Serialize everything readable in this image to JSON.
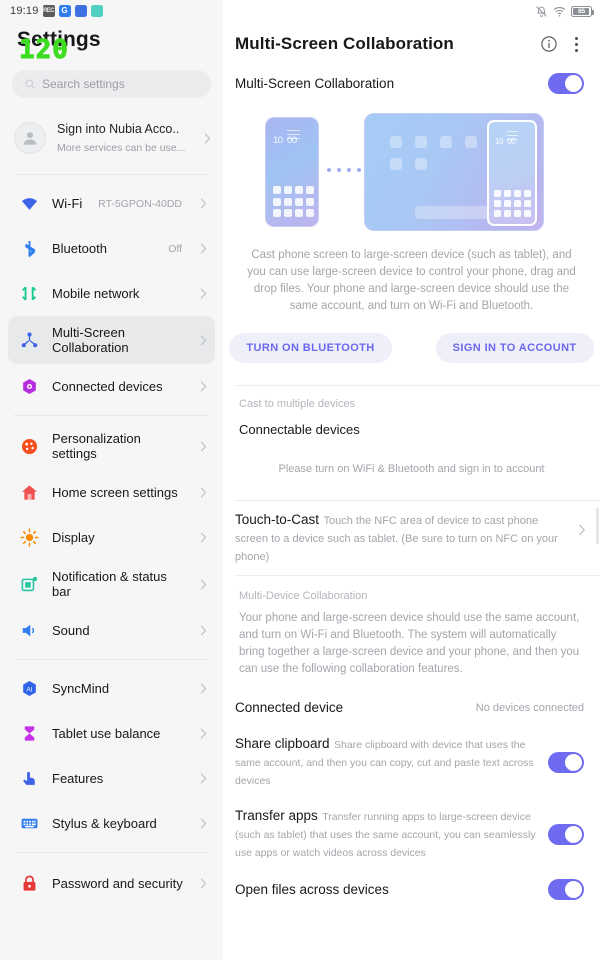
{
  "status_bar": {
    "time": "19:19",
    "left_icons": [
      "recorder-chip",
      "google-chip",
      "blue-app-chip",
      "teal-app-chip"
    ],
    "right_icons": [
      "mute-icon",
      "wifi-icon",
      "battery-icon"
    ],
    "battery_level": "85"
  },
  "sidebar": {
    "title": "Settings",
    "fps_overlay": "120",
    "search": {
      "placeholder": "Search settings",
      "icon": "search-icon"
    },
    "account": {
      "title": "Sign into Nubia Acco..",
      "subtitle": "More services can be use...",
      "icon": "avatar-icon"
    },
    "items": [
      {
        "label": "Wi-Fi",
        "value": "RT-5GPON-40DD",
        "icon": "wifi-icon",
        "selected": false
      },
      {
        "label": "Bluetooth",
        "value": "Off",
        "icon": "bluetooth-icon",
        "selected": false
      },
      {
        "label": "Mobile network",
        "value": "",
        "icon": "mobile-network-icon",
        "selected": false
      },
      {
        "label": "Multi-Screen Collaboration",
        "value": "",
        "icon": "multi-screen-icon",
        "selected": true
      },
      {
        "label": "Connected devices",
        "value": "",
        "icon": "connected-devices-icon",
        "selected": false
      },
      {
        "label": "Personalization settings",
        "value": "",
        "icon": "palette-icon",
        "selected": false
      },
      {
        "label": "Home screen settings",
        "value": "",
        "icon": "home-icon",
        "selected": false
      },
      {
        "label": "Display",
        "value": "",
        "icon": "sun-icon",
        "selected": false
      },
      {
        "label": "Notification & status bar",
        "value": "",
        "icon": "notification-icon",
        "selected": false
      },
      {
        "label": "Sound",
        "value": "",
        "icon": "speaker-icon",
        "selected": false
      },
      {
        "label": "SyncMind",
        "value": "",
        "icon": "ai-icon",
        "selected": false
      },
      {
        "label": "Tablet use balance",
        "value": "",
        "icon": "hourglass-icon",
        "selected": false
      },
      {
        "label": "Features",
        "value": "",
        "icon": "gesture-icon",
        "selected": false
      },
      {
        "label": "Stylus & keyboard",
        "value": "",
        "icon": "keyboard-icon",
        "selected": false
      },
      {
        "label": "Password and security",
        "value": "",
        "icon": "lock-icon",
        "selected": false
      }
    ]
  },
  "main": {
    "header": {
      "title": "Multi-Screen Collaboration",
      "info_icon": "info-icon",
      "menu_icon": "kebab-menu-icon"
    },
    "master_toggle": {
      "label": "Multi-Screen Collaboration",
      "state": "on"
    },
    "illustration": {
      "phone_clock_hour": "10",
      "phone_clock_min": "00",
      "tablet_phone_clock_hour": "10",
      "tablet_phone_clock_min": "00"
    },
    "description": "Cast phone screen to large-screen device (such as tablet), and you can use large-screen device to control your phone, drag and drop files. Your phone and large-screen device should use the same account, and turn on Wi-Fi and Bluetooth.",
    "buttons": [
      {
        "label": "TURN ON BLUETOOTH"
      },
      {
        "label": "SIGN IN TO ACCOUNT"
      }
    ],
    "cast_section": {
      "label": "Cast to multiple devices",
      "subhead": "Connectable devices",
      "hint": "Please turn on WiFi & Bluetooth and sign in to account"
    },
    "touch_to_cast": {
      "title": "Touch-to-Cast",
      "subtitle": "Touch the NFC area of device to cast phone screen to a device such as tablet. (Be sure to turn on NFC on your phone)"
    },
    "multi_device": {
      "label": "Multi-Device Collaboration",
      "paragraph": "Your phone and large-screen device should use the same account, and turn on Wi-Fi and Bluetooth. The system will automatically bring together a large-screen device and your phone, and then you can use the following collaboration features.",
      "connected_device_label": "Connected device",
      "connected_device_value": "No devices connected",
      "features": [
        {
          "title": "Share clipboard",
          "subtitle": "Share clipboard with device that uses the same account, and then you can copy, cut and paste text across devices",
          "state": "on"
        },
        {
          "title": "Transfer apps",
          "subtitle": "Transfer running apps to large-screen device (such as tablet) that uses the same account, you can seamlessly use apps or watch videos across devices",
          "state": "on"
        },
        {
          "title": "Open files across devices",
          "subtitle": "",
          "state": "on"
        }
      ]
    }
  },
  "colors": {
    "accent_purple": "#6f6bf0",
    "pill_bg": "#efeffa",
    "fps_green": "#3ddd21",
    "selected_row": "#e8e9ea"
  }
}
